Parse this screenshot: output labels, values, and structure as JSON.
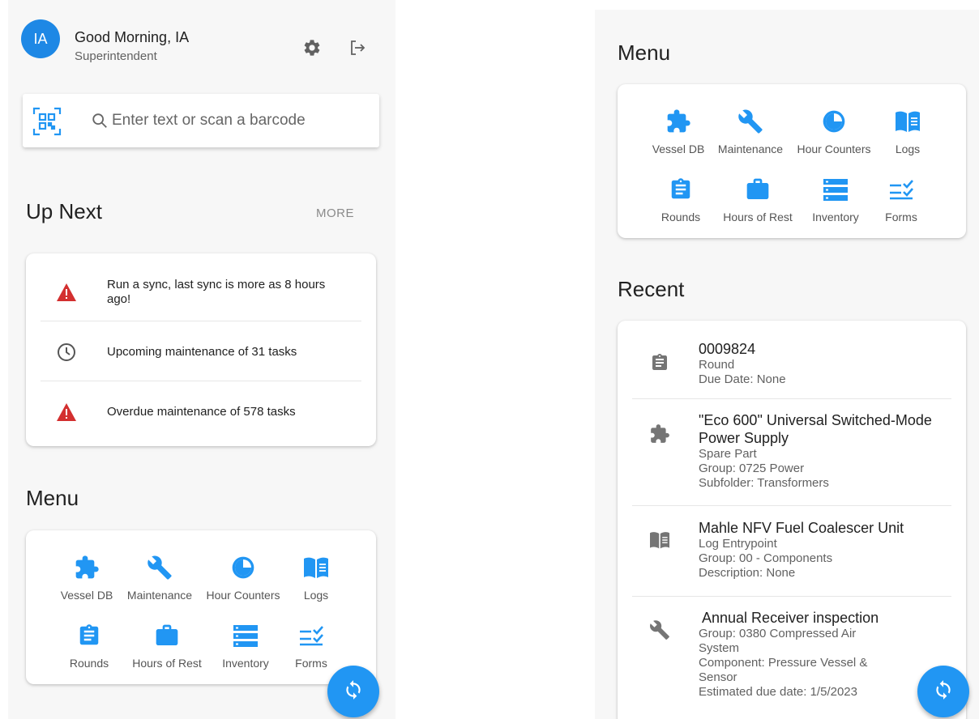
{
  "user": {
    "initials": "IA",
    "greeting": "Good Morning, IA",
    "role": "Superintendent"
  },
  "search": {
    "placeholder": "Enter text or scan a barcode"
  },
  "up_next": {
    "title": "Up Next",
    "more_label": "MORE",
    "items": [
      {
        "icon": "warning-icon",
        "text": "Run a sync, last sync is more as 8 hours ago!"
      },
      {
        "icon": "clock-icon",
        "text": "Upcoming maintenance of 31 tasks"
      },
      {
        "icon": "warning-icon",
        "text": "Overdue maintenance of 578 tasks"
      }
    ]
  },
  "menu": {
    "title": "Menu",
    "items": [
      {
        "icon": "puzzle-icon",
        "label": "Vessel DB"
      },
      {
        "icon": "wrench-icon",
        "label": "Maintenance"
      },
      {
        "icon": "timer-icon",
        "label": "Hour Counters"
      },
      {
        "icon": "book-icon",
        "label": "Logs"
      },
      {
        "icon": "clipboard-icon",
        "label": "Rounds"
      },
      {
        "icon": "briefcase-icon",
        "label": "Hours of Rest"
      },
      {
        "icon": "inventory-list-icon",
        "label": "Inventory"
      },
      {
        "icon": "checklist-icon",
        "label": "Forms"
      }
    ]
  },
  "recent": {
    "title": "Recent",
    "items": [
      {
        "icon": "clipboard-icon",
        "title": "0009824",
        "lines": [
          "Round",
          "Due Date: None"
        ]
      },
      {
        "icon": "puzzle-icon",
        "title": "\"Eco 600\" Universal Switched-Mode Power Supply",
        "lines": [
          "Spare Part",
          "Group: 0725 Power",
          "Subfolder: Transformers"
        ]
      },
      {
        "icon": "book-icon",
        "title": "Mahle NFV Fuel Coalescer Unit",
        "lines": [
          "Log Entrypoint",
          "Group: 00 - Components",
          "Description: None"
        ]
      },
      {
        "icon": "wrench-icon",
        "title": " Annual Receiver inspection",
        "lines": [
          "Group: 0380 Compressed Air System",
          "Component: Pressure Vessel & Sensor",
          "Estimated due date: 1/5/2023"
        ]
      }
    ]
  },
  "colors": {
    "accent": "#2196f3",
    "avatar": "#1e88e5",
    "warning": "#d32f2f",
    "muted_icon": "#757575"
  }
}
